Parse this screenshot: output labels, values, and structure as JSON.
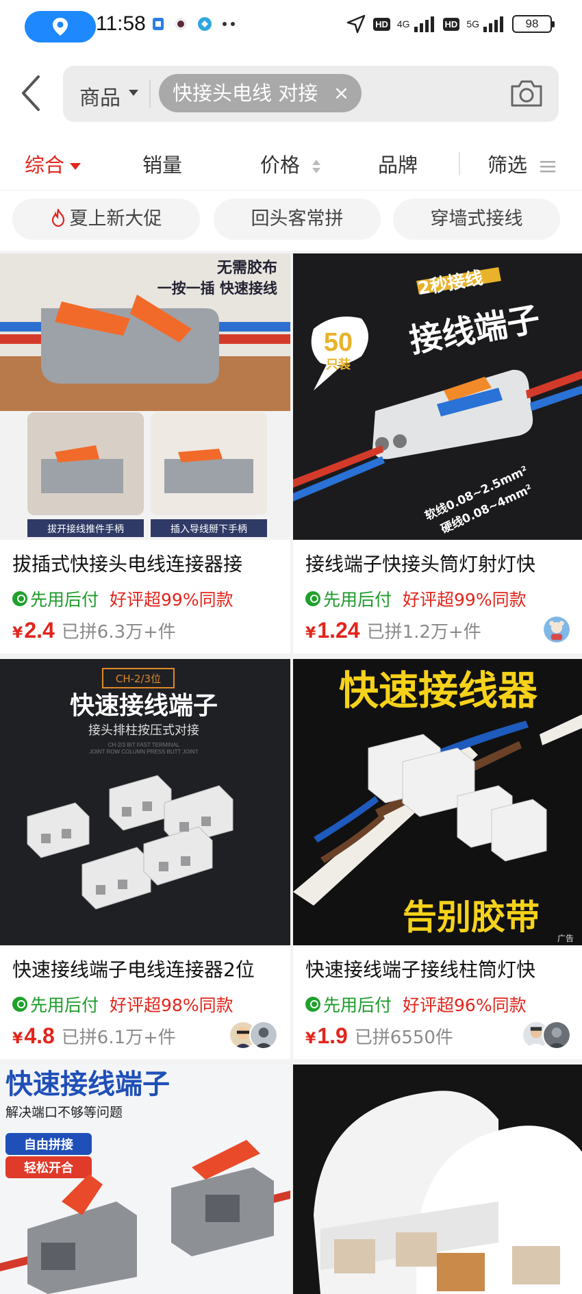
{
  "status_bar": {
    "time": "11:58",
    "network_4g": "4G",
    "network_5g": "5G",
    "hd_badge": "HD",
    "battery": "98"
  },
  "search": {
    "category": "商品",
    "query": "快接头电线 对接",
    "clear_symbol": "×"
  },
  "sort_tabs": [
    {
      "label": "综合"
    },
    {
      "label": "销量"
    },
    {
      "label": "价格"
    },
    {
      "label": "品牌"
    },
    {
      "label": "筛选"
    }
  ],
  "quick_tags": [
    {
      "label": "夏上新大促"
    },
    {
      "label": "回头客常拼"
    },
    {
      "label": "穿墙式接线"
    }
  ],
  "products": [
    {
      "title": "拔插式快接头电线连接器接",
      "pay_label": "先用后付",
      "review_label": "好评超99%同款",
      "currency": "¥",
      "price": "2.4",
      "sold": "已拼6.3万+件",
      "image_texts": {
        "headline_1": "无需胶布",
        "headline_2": "一按一插 快速接线",
        "caption_left": "拔开接线推件手柄",
        "caption_right": "插入导线掰下手柄"
      }
    },
    {
      "title": "接线端子快接头筒灯射灯快",
      "pay_label": "先用后付",
      "review_label": "好评超99%同款",
      "currency": "¥",
      "price": "1.24",
      "sold": "已拼1.2万+件",
      "image_texts": {
        "banner": "2秒接线",
        "headline": "接线端子",
        "bubble_num": "50",
        "bubble_unit": "只装",
        "spec_1": "软线0.08~2.5mm²",
        "spec_2": "硬线0.08~4mm²"
      }
    },
    {
      "title": "快速接线端子电线连接器2位",
      "pay_label": "先用后付",
      "review_label": "好评超98%同款",
      "currency": "¥",
      "price": "4.8",
      "sold": "已拼6.1万+件",
      "image_texts": {
        "tag": "CH-2/3位",
        "headline": "快速接线端子",
        "sub": "接头排柱按压式对接",
        "tiny_1": "CH-2/3 BIT FAST TERMINAL",
        "tiny_2": "JOINT ROW COLUMN PRESS BUTT JOINT"
      }
    },
    {
      "title": "快速接线端子接线柱筒灯快",
      "pay_label": "先用后付",
      "review_label": "好评超96%同款",
      "currency": "¥",
      "price": "1.9",
      "sold": "已拼6550件",
      "image_texts": {
        "headline": "快速接线器",
        "footer": "告别胶带",
        "ad": "广告"
      }
    },
    {
      "image_texts": {
        "headline": "快速接线端子",
        "sub": "解决端口不够等问题",
        "badge_1": "自由拼接",
        "badge_2": "轻松开合"
      }
    },
    {
      "image_texts": {}
    }
  ],
  "colors": {
    "accent_red": "#e1251b",
    "pay_green": "#1b9a28",
    "location_blue": "#1e88ff"
  }
}
